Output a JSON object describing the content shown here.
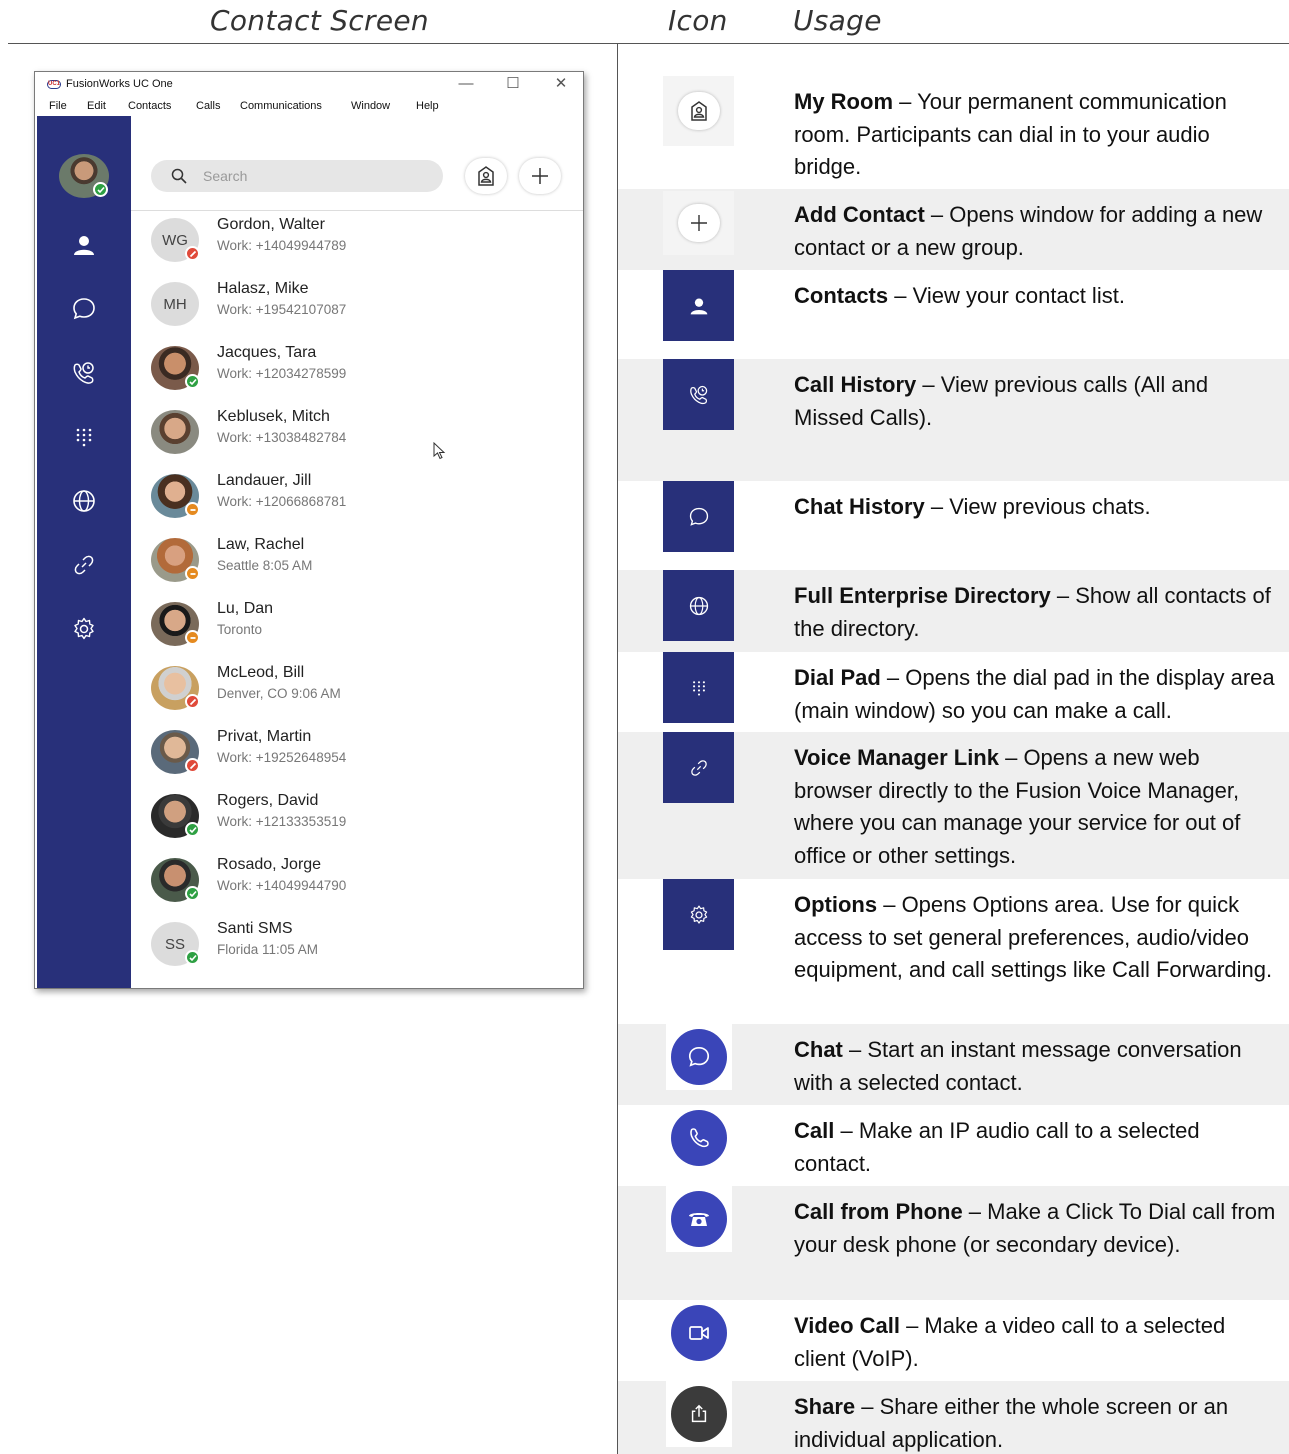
{
  "header": {
    "col1": "Contact Screen",
    "col2": "Icon",
    "col3": "Usage"
  },
  "app": {
    "title": "FusionWorks UC One",
    "logo_text": "UC1",
    "menu": [
      "File",
      "Edit",
      "Contacts",
      "Calls",
      "Communications",
      "Window",
      "Help"
    ],
    "search_placeholder": "Search",
    "contacts": [
      {
        "initials": "WG",
        "name": "Gordon, Walter",
        "sub": "Work: +14049944789",
        "status": "busy"
      },
      {
        "initials": "MH",
        "name": "Halasz, Mike",
        "sub": "Work: +19542107087",
        "status": "none"
      },
      {
        "initials": "",
        "name": "Jacques, Tara",
        "sub": "Work: +12034278599",
        "status": "ok"
      },
      {
        "initials": "",
        "name": "Keblusek, Mitch",
        "sub": "Work: +13038482784",
        "status": "none"
      },
      {
        "initials": "",
        "name": "Landauer, Jill",
        "sub": "Work: +12066868781",
        "status": "away"
      },
      {
        "initials": "",
        "name": "Law, Rachel",
        "sub": "Seattle 8:05 AM",
        "status": "away"
      },
      {
        "initials": "",
        "name": "Lu, Dan",
        "sub": "Toronto",
        "status": "away"
      },
      {
        "initials": "",
        "name": "McLeod, Bill",
        "sub": "Denver, CO 9:06 AM",
        "status": "busy"
      },
      {
        "initials": "",
        "name": "Privat, Martin",
        "sub": "Work: +19252648954",
        "status": "busy"
      },
      {
        "initials": "",
        "name": "Rogers, David",
        "sub": "Work: +12133353519",
        "status": "ok"
      },
      {
        "initials": "",
        "name": "Rosado, Jorge",
        "sub": "Work: +14049944790",
        "status": "ok"
      },
      {
        "initials": "SS",
        "name": "Santi SMS",
        "sub": "Florida 11:05 AM",
        "status": "ok"
      }
    ]
  },
  "usage": [
    {
      "icon": "my-room-icon",
      "title": "My Room",
      "desc": " – Your permanent communication room. Participants can dial in to your audio bridge."
    },
    {
      "icon": "plus-icon",
      "title": "Add Contact",
      "desc": " – Opens window for adding a new contact or a new group."
    },
    {
      "icon": "contacts-icon",
      "title": "Contacts",
      "desc": " – View your contact list."
    },
    {
      "icon": "call-history-icon",
      "title": "Call History",
      "desc": " – View previous calls (All and Missed Calls)."
    },
    {
      "icon": "chat-history-icon",
      "title": "Chat History",
      "desc": " – View previous chats."
    },
    {
      "icon": "globe-icon",
      "title": "Full Enterprise Directory",
      "desc": " – Show all contacts of the directory."
    },
    {
      "icon": "dial-pad-icon",
      "title": "Dial Pad",
      "desc": " – Opens the dial pad in the display area (main window) so you can make a call."
    },
    {
      "icon": "link-icon",
      "title": "Voice Manager Link",
      "desc": " – Opens a new web browser directly to the Fusion Voice Manager, where you can manage your service for out of office or other settings."
    },
    {
      "icon": "gear-icon",
      "title": "Options",
      "desc": " – Opens Options area. Use for quick access to set general preferences, audio/video equipment, and call settings like Call Forwarding."
    },
    {
      "icon": "chat-icon",
      "title": "Chat",
      "desc": " – Start an instant message conversation with a selected contact."
    },
    {
      "icon": "phone-icon",
      "title": "Call",
      "desc": " – Make an IP audio call to a selected contact."
    },
    {
      "icon": "desk-phone-icon",
      "title": "Call from Phone",
      "desc": " – Make a Click To Dial call from your desk phone (or secondary device)."
    },
    {
      "icon": "video-icon",
      "title": "Video Call",
      "desc": " – Make a video call to a selected client (VoIP)."
    },
    {
      "icon": "share-icon",
      "title": "Share",
      "desc": " – Share either the whole screen or an individual application."
    }
  ],
  "colors": {
    "sidebar": "#28307a",
    "action_blue": "#3a45b8",
    "share_dark": "#3b3b3b",
    "status_ok": "#2ea043",
    "status_busy": "#e04a3a",
    "status_away": "#e58a1f"
  }
}
